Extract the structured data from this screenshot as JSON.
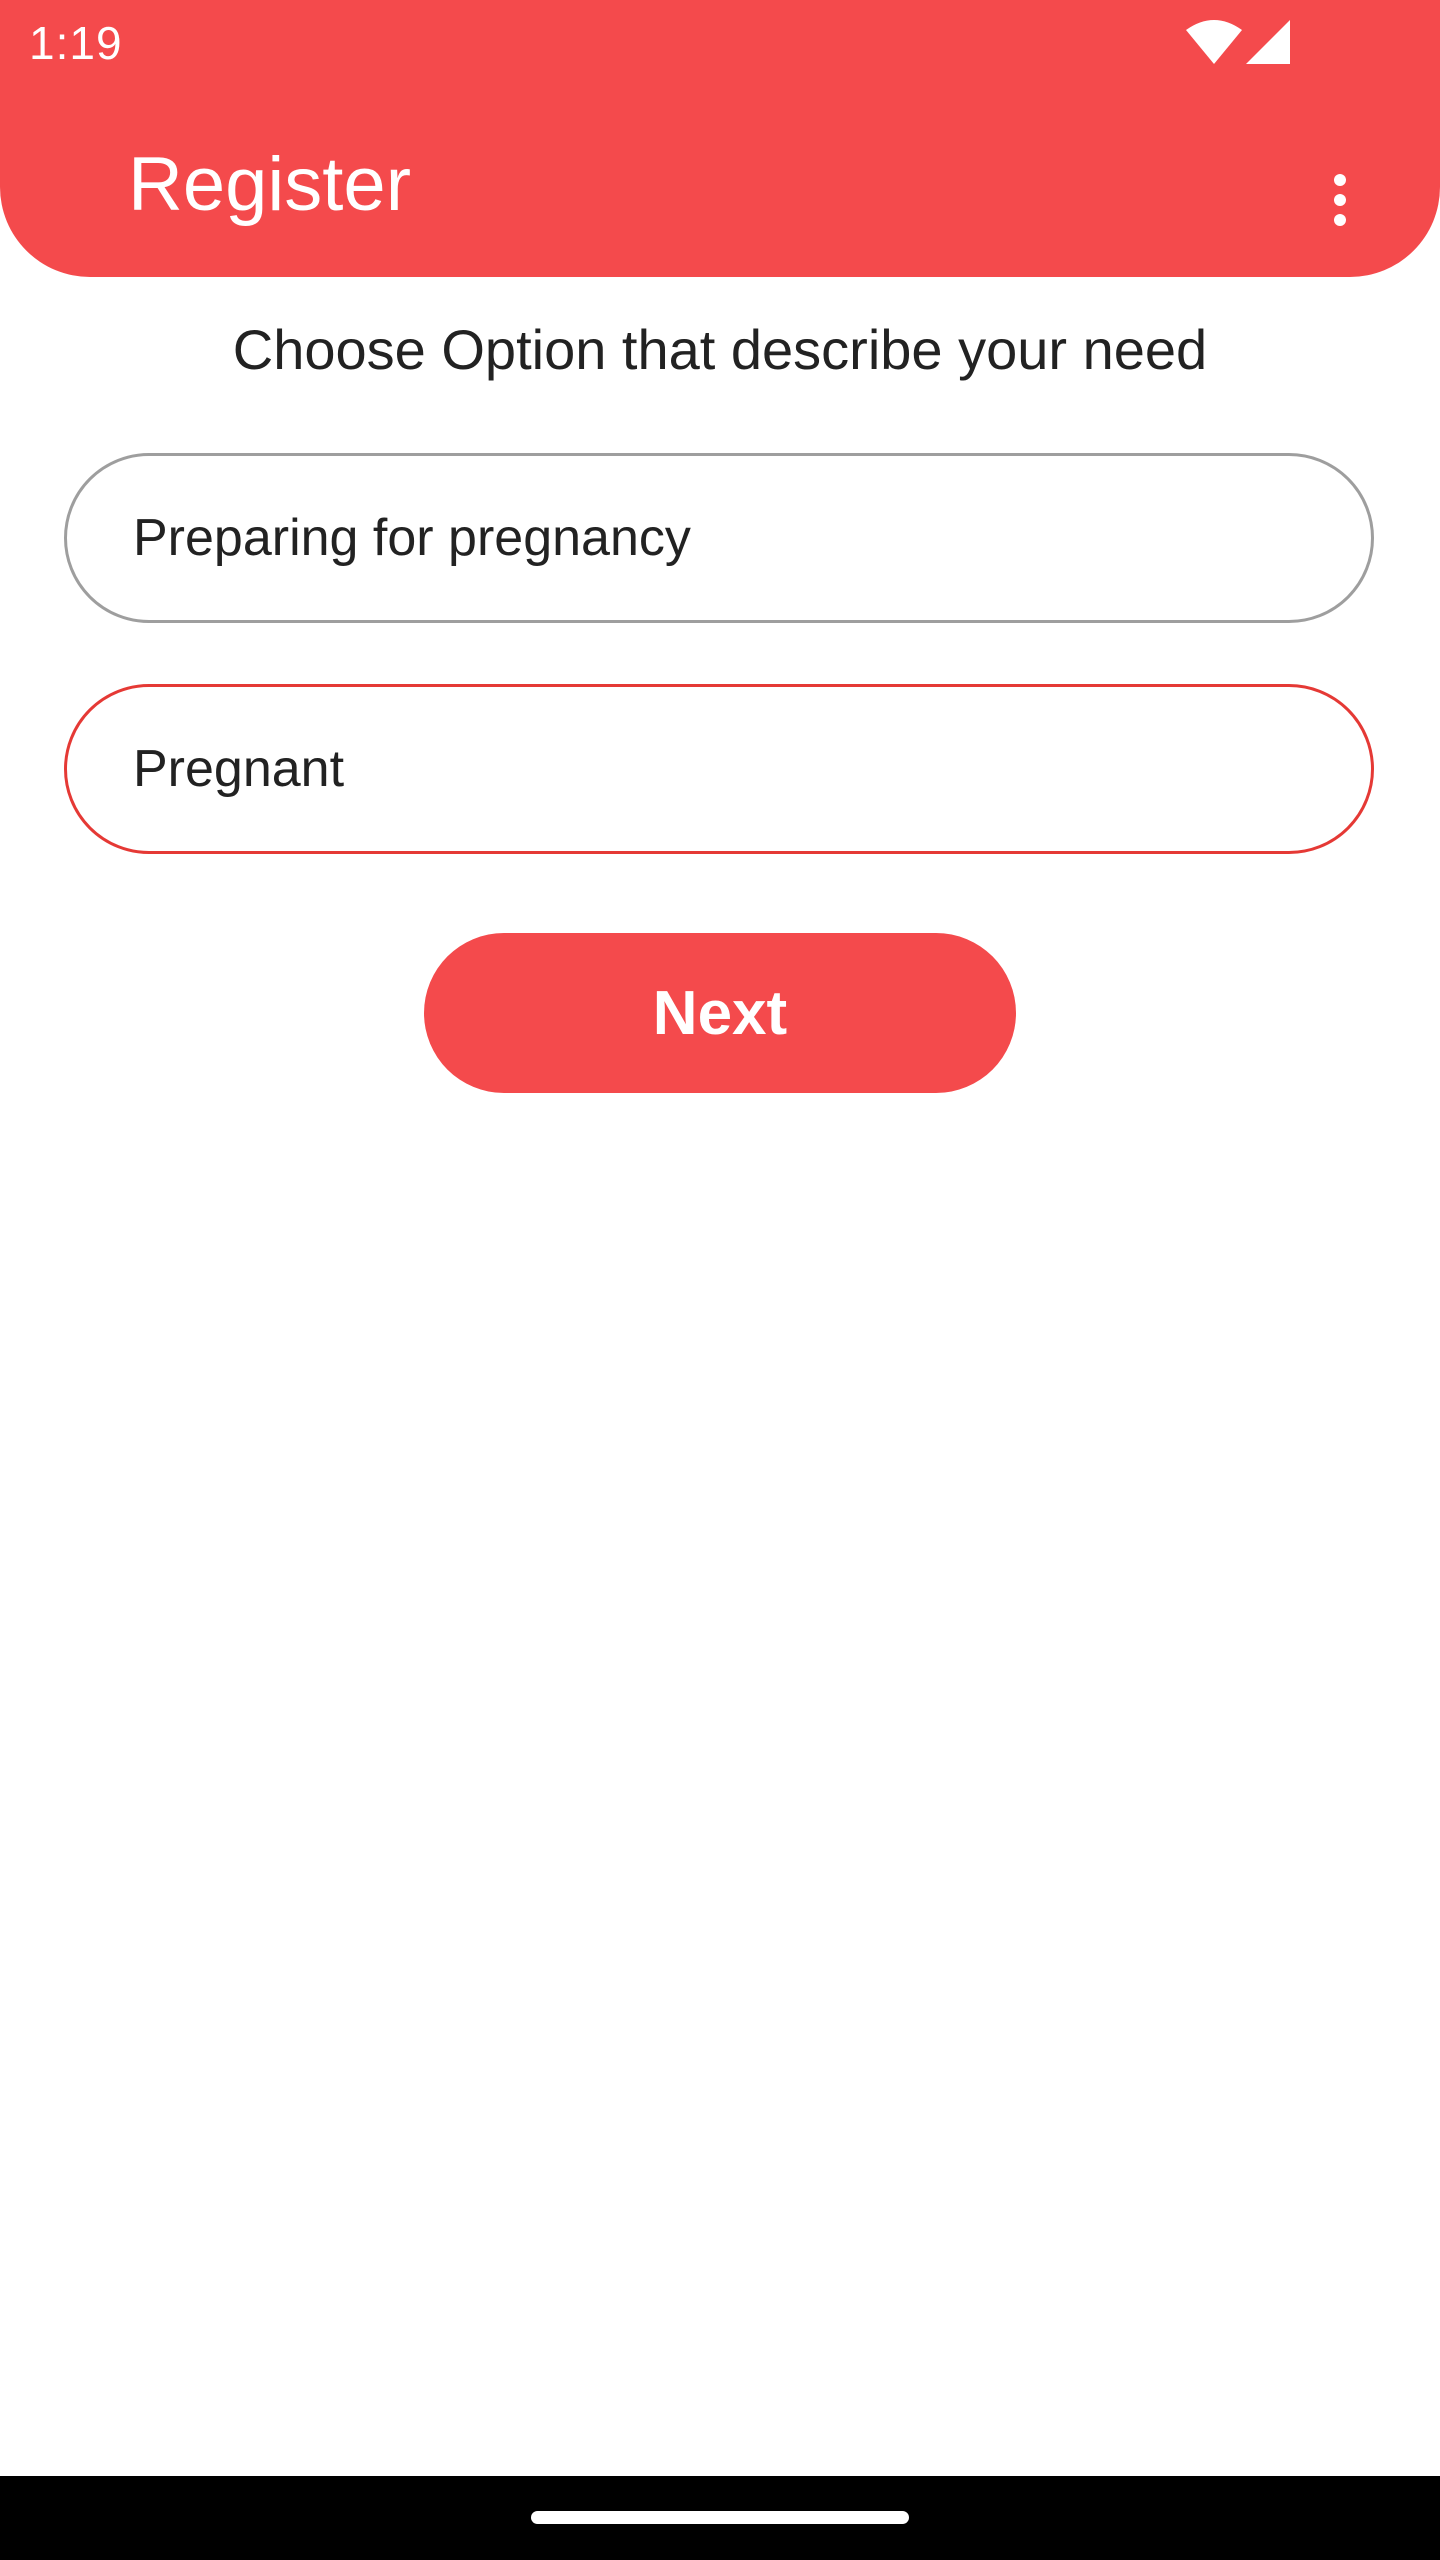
{
  "status_bar": {
    "time": "1:19",
    "icons": [
      "wifi-icon",
      "signal-icon"
    ]
  },
  "header": {
    "title": "Register",
    "menu_icon": "more-vertical-icon"
  },
  "main": {
    "subtitle": "Choose Option that describe your need",
    "options": [
      {
        "label": "Preparing for pregnancy",
        "selected": false
      },
      {
        "label": "Pregnant",
        "selected": true
      }
    ],
    "next_label": "Next"
  },
  "colors": {
    "accent": "#f44a4c",
    "selected_border": "#e53935",
    "unselected_border": "#9e9e9e",
    "text": "#222222"
  }
}
